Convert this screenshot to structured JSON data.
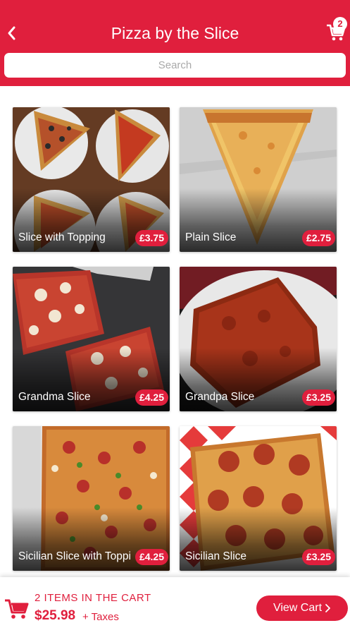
{
  "header": {
    "title": "Pizza by the Slice",
    "cart_badge": "2",
    "background": "#e01f3d"
  },
  "search": {
    "placeholder": "Search"
  },
  "products": [
    {
      "name": "Slice with Topping",
      "price": "£3.75"
    },
    {
      "name": "Plain Slice",
      "price": "£2.75"
    },
    {
      "name": "Grandma Slice",
      "price": "£4.25"
    },
    {
      "name": "Grandpa Slice",
      "price": "£3.25"
    },
    {
      "name": "Sicilian Slice with Toppi",
      "price": "£4.25"
    },
    {
      "name": "Sicilian Slice",
      "price": "£3.25"
    }
  ],
  "cart_bar": {
    "count_text": "2 ITEMS IN THE CART",
    "total": "$25.98",
    "taxes": "+ Taxes",
    "button_label": "View Cart"
  },
  "icons": [
    "back-arrow-icon",
    "cart-icon",
    "chevron-right-icon"
  ],
  "colors": {
    "accent": "#e01f3d"
  }
}
